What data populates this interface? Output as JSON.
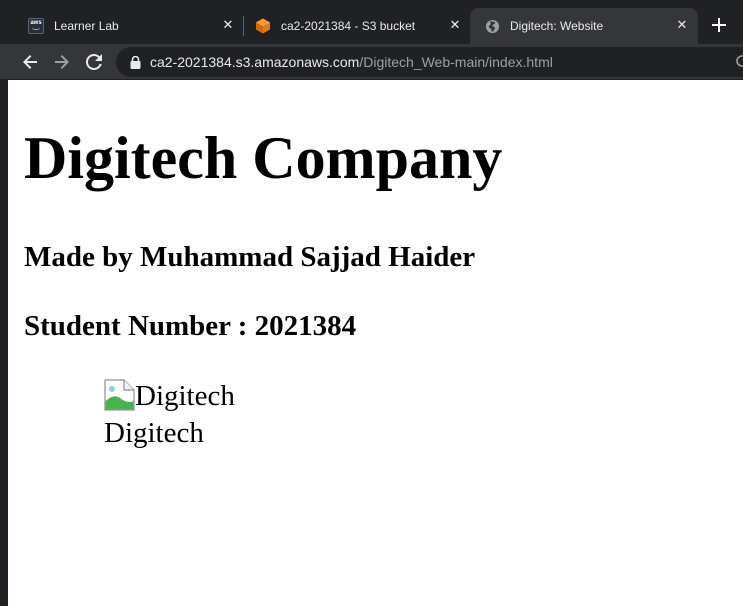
{
  "browser": {
    "tabs": [
      {
        "title": "Learner Lab",
        "favicon": "aws-icon",
        "active": false
      },
      {
        "title": "ca2-2021384 - S3 bucket",
        "favicon": "s3-bucket-icon",
        "active": false
      },
      {
        "title": "Digitech: Website",
        "favicon": "globe-icon",
        "active": true
      }
    ],
    "new_tab_icon": "plus-icon",
    "url_host": "ca2-2021384.s3.amazonaws.com",
    "url_path": "/Digitech_Web-main/index.html"
  },
  "page": {
    "heading": "Digitech Company",
    "made_by": "Made by Muhammad Sajjad Haider",
    "student_number": "Student Number : 2021384",
    "image_alt": "Digitech",
    "caption": "Digitech"
  },
  "colors": {
    "tab_strip": "#202124",
    "toolbar": "#35363a",
    "omnibox": "#202124",
    "s3_orange": "#e47911"
  }
}
